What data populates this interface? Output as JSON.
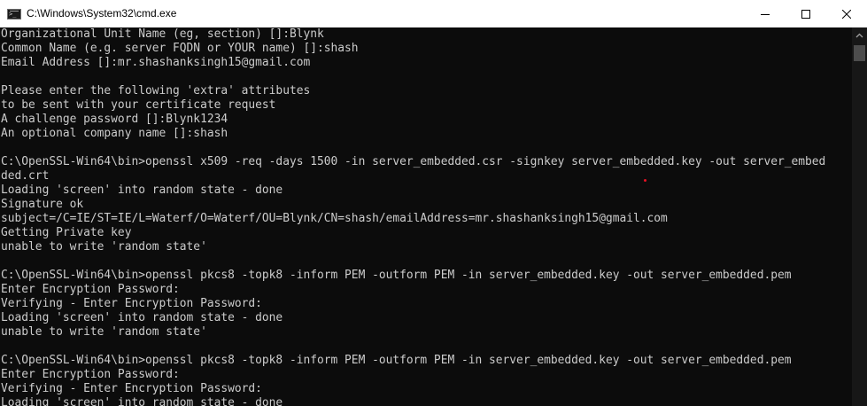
{
  "window": {
    "title": "C:\\Windows\\System32\\cmd.exe"
  },
  "icons": {
    "app": "cmd-console-icon",
    "minimize": "minimize-icon",
    "maximize": "maximize-icon",
    "close": "close-icon",
    "scroll_up": "scroll-up-arrow-icon"
  },
  "colors": {
    "background": "#0c0c0c",
    "text": "#cccccc",
    "titlebar": "#ffffff",
    "scrollbar_track": "#171717",
    "scrollbar_thumb": "#4d4d4d"
  },
  "console": {
    "lines": [
      "Organizational Unit Name (eg, section) []:Blynk",
      "Common Name (e.g. server FQDN or YOUR name) []:shash",
      "Email Address []:mr.shashanksingh15@gmail.com",
      "",
      "Please enter the following 'extra' attributes",
      "to be sent with your certificate request",
      "A challenge password []:Blynk1234",
      "An optional company name []:shash",
      "",
      "C:\\OpenSSL-Win64\\bin>openssl x509 -req -days 1500 -in server_embedded.csr -signkey server_embedded.key -out server_embed",
      "ded.crt",
      "Loading 'screen' into random state - done",
      "Signature ok",
      "subject=/C=IE/ST=IE/L=Waterf/O=Waterf/OU=Blynk/CN=shash/emailAddress=mr.shashanksingh15@gmail.com",
      "Getting Private key",
      "unable to write 'random state'",
      "",
      "C:\\OpenSSL-Win64\\bin>openssl pkcs8 -topk8 -inform PEM -outform PEM -in server_embedded.key -out server_embedded.pem",
      "Enter Encryption Password:",
      "Verifying - Enter Encryption Password:",
      "Loading 'screen' into random state - done",
      "unable to write 'random state'",
      "",
      "C:\\OpenSSL-Win64\\bin>openssl pkcs8 -topk8 -inform PEM -outform PEM -in server_embedded.key -out server_embedded.pem",
      "Enter Encryption Password:",
      "Verifying - Enter Encryption Password:",
      "Loading 'screen' into random state - done"
    ]
  }
}
